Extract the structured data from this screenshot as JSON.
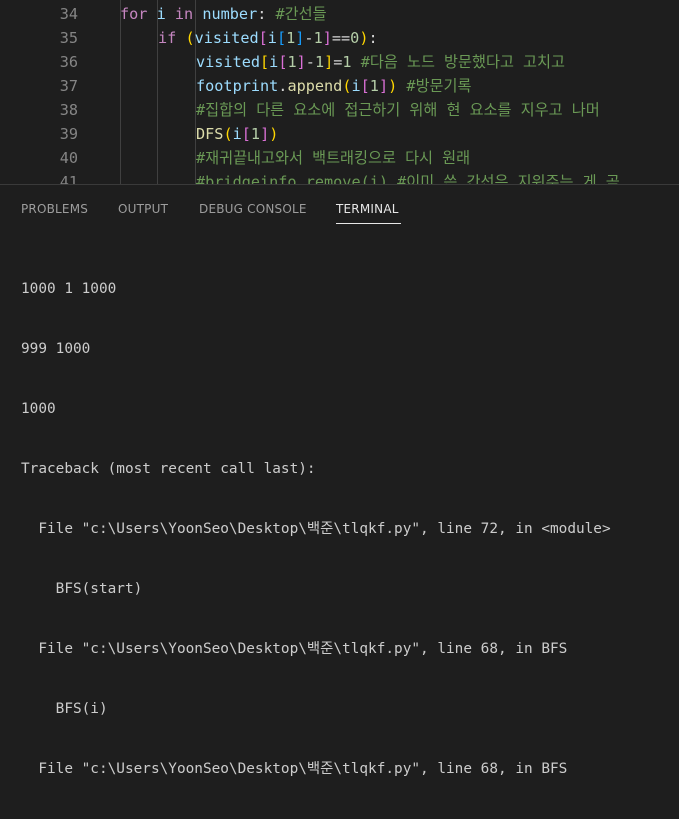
{
  "editor": {
    "lines": [
      {
        "num": "34",
        "indent": 0,
        "tokens": [
          {
            "t": "for",
            "c": "tk-kw"
          },
          {
            "t": " ",
            "c": "tk-op"
          },
          {
            "t": "i",
            "c": "tk-var"
          },
          {
            "t": " ",
            "c": "tk-op"
          },
          {
            "t": "in",
            "c": "tk-kw"
          },
          {
            "t": " ",
            "c": "tk-op"
          },
          {
            "t": "number",
            "c": "tk-var"
          },
          {
            "t": ": ",
            "c": "tk-op"
          },
          {
            "t": "#간선들",
            "c": "tk-cm"
          }
        ]
      },
      {
        "num": "35",
        "indent": 1,
        "tokens": [
          {
            "t": "if",
            "c": "tk-kw"
          },
          {
            "t": " ",
            "c": "tk-op"
          },
          {
            "t": "(",
            "c": "tk-br3"
          },
          {
            "t": "visited",
            "c": "tk-var"
          },
          {
            "t": "[",
            "c": "tk-br1"
          },
          {
            "t": "i",
            "c": "tk-var"
          },
          {
            "t": "[",
            "c": "tk-br2"
          },
          {
            "t": "1",
            "c": "tk-num"
          },
          {
            "t": "]",
            "c": "tk-br2"
          },
          {
            "t": "-",
            "c": "tk-op"
          },
          {
            "t": "1",
            "c": "tk-num"
          },
          {
            "t": "]",
            "c": "tk-br1"
          },
          {
            "t": "==",
            "c": "tk-op"
          },
          {
            "t": "0",
            "c": "tk-num"
          },
          {
            "t": ")",
            "c": "tk-br3"
          },
          {
            "t": ":",
            "c": "tk-op"
          }
        ]
      },
      {
        "num": "36",
        "indent": 2,
        "tokens": [
          {
            "t": "visited",
            "c": "tk-var"
          },
          {
            "t": "[",
            "c": "tk-br3"
          },
          {
            "t": "i",
            "c": "tk-var"
          },
          {
            "t": "[",
            "c": "tk-br1"
          },
          {
            "t": "1",
            "c": "tk-num"
          },
          {
            "t": "]",
            "c": "tk-br1"
          },
          {
            "t": "-",
            "c": "tk-op"
          },
          {
            "t": "1",
            "c": "tk-num"
          },
          {
            "t": "]",
            "c": "tk-br3"
          },
          {
            "t": "=",
            "c": "tk-op"
          },
          {
            "t": "1",
            "c": "tk-num"
          },
          {
            "t": " ",
            "c": "tk-op"
          },
          {
            "t": "#다음 노드 방문했다고 고치고",
            "c": "tk-cm"
          }
        ]
      },
      {
        "num": "37",
        "indent": 2,
        "tokens": [
          {
            "t": "footprint",
            "c": "tk-var"
          },
          {
            "t": ".",
            "c": "tk-op"
          },
          {
            "t": "append",
            "c": "tk-fn"
          },
          {
            "t": "(",
            "c": "tk-br3"
          },
          {
            "t": "i",
            "c": "tk-var"
          },
          {
            "t": "[",
            "c": "tk-br1"
          },
          {
            "t": "1",
            "c": "tk-num"
          },
          {
            "t": "]",
            "c": "tk-br1"
          },
          {
            "t": ")",
            "c": "tk-br3"
          },
          {
            "t": " ",
            "c": "tk-op"
          },
          {
            "t": "#방문기록",
            "c": "tk-cm"
          }
        ]
      },
      {
        "num": "38",
        "indent": 2,
        "tokens": [
          {
            "t": "#집합의 다른 요소에 접근하기 위해 현 요소를 지우고 나머",
            "c": "tk-cm"
          }
        ]
      },
      {
        "num": "39",
        "indent": 2,
        "tokens": [
          {
            "t": "DFS",
            "c": "tk-fn"
          },
          {
            "t": "(",
            "c": "tk-br3"
          },
          {
            "t": "i",
            "c": "tk-var"
          },
          {
            "t": "[",
            "c": "tk-br1"
          },
          {
            "t": "1",
            "c": "tk-num"
          },
          {
            "t": "]",
            "c": "tk-br1"
          },
          {
            "t": ")",
            "c": "tk-br3"
          }
        ]
      },
      {
        "num": "40",
        "indent": 2,
        "tokens": [
          {
            "t": "#재귀끝내고와서 백트래킹으로 다시 원래",
            "c": "tk-cm"
          }
        ]
      },
      {
        "num": "41",
        "indent": 2,
        "tokens": [
          {
            "t": "#bridgeinfo.remove(i) #이미 쓴 간선은 지워주는 게 곧",
            "c": "tk-cm"
          }
        ]
      }
    ]
  },
  "panel": {
    "tabs": [
      {
        "label": "PROBLEMS",
        "active": false
      },
      {
        "label": "OUTPUT",
        "active": false
      },
      {
        "label": "DEBUG CONSOLE",
        "active": false
      },
      {
        "label": "TERMINAL",
        "active": true
      }
    ],
    "terminal_lines": [
      "1000 1 1000",
      "999 1000",
      "1000",
      "Traceback (most recent call last):",
      "  File \"c:\\Users\\YoonSeo\\Desktop\\백준\\tlqkf.py\", line 72, in <module>",
      "    BFS(start)",
      "  File \"c:\\Users\\YoonSeo\\Desktop\\백준\\tlqkf.py\", line 68, in BFS",
      "    BFS(i)",
      "  File \"c:\\Users\\YoonSeo\\Desktop\\백준\\tlqkf.py\", line 68, in BFS"
    ]
  }
}
